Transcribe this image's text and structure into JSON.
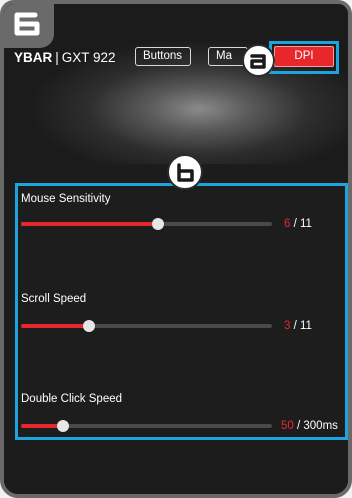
{
  "step_badge": {
    "icon": "digit-6-icon"
  },
  "header": {
    "brand_name": "YBAR",
    "brand_separator": "|",
    "brand_model": "GXT 922",
    "tabs": [
      {
        "label": "Buttons"
      },
      {
        "label": "Ma"
      },
      {
        "label": "DPI",
        "active": true,
        "color": "#e8272c"
      }
    ]
  },
  "callouts": {
    "a": "callout-a-icon",
    "b": "callout-b-icon"
  },
  "highlight_color": "#1fa3dc",
  "settings": [
    {
      "label": "Mouse Sensitivity",
      "value": 6,
      "max": 11,
      "value_text": "6",
      "max_text": " / 11"
    },
    {
      "label": "Scroll Speed",
      "value": 3,
      "max": 11,
      "value_text": "3",
      "max_text": " / 11"
    },
    {
      "label": "Double Click Speed",
      "value": 50,
      "max": 300,
      "value_text": "50",
      "max_text": " / 300ms"
    }
  ]
}
